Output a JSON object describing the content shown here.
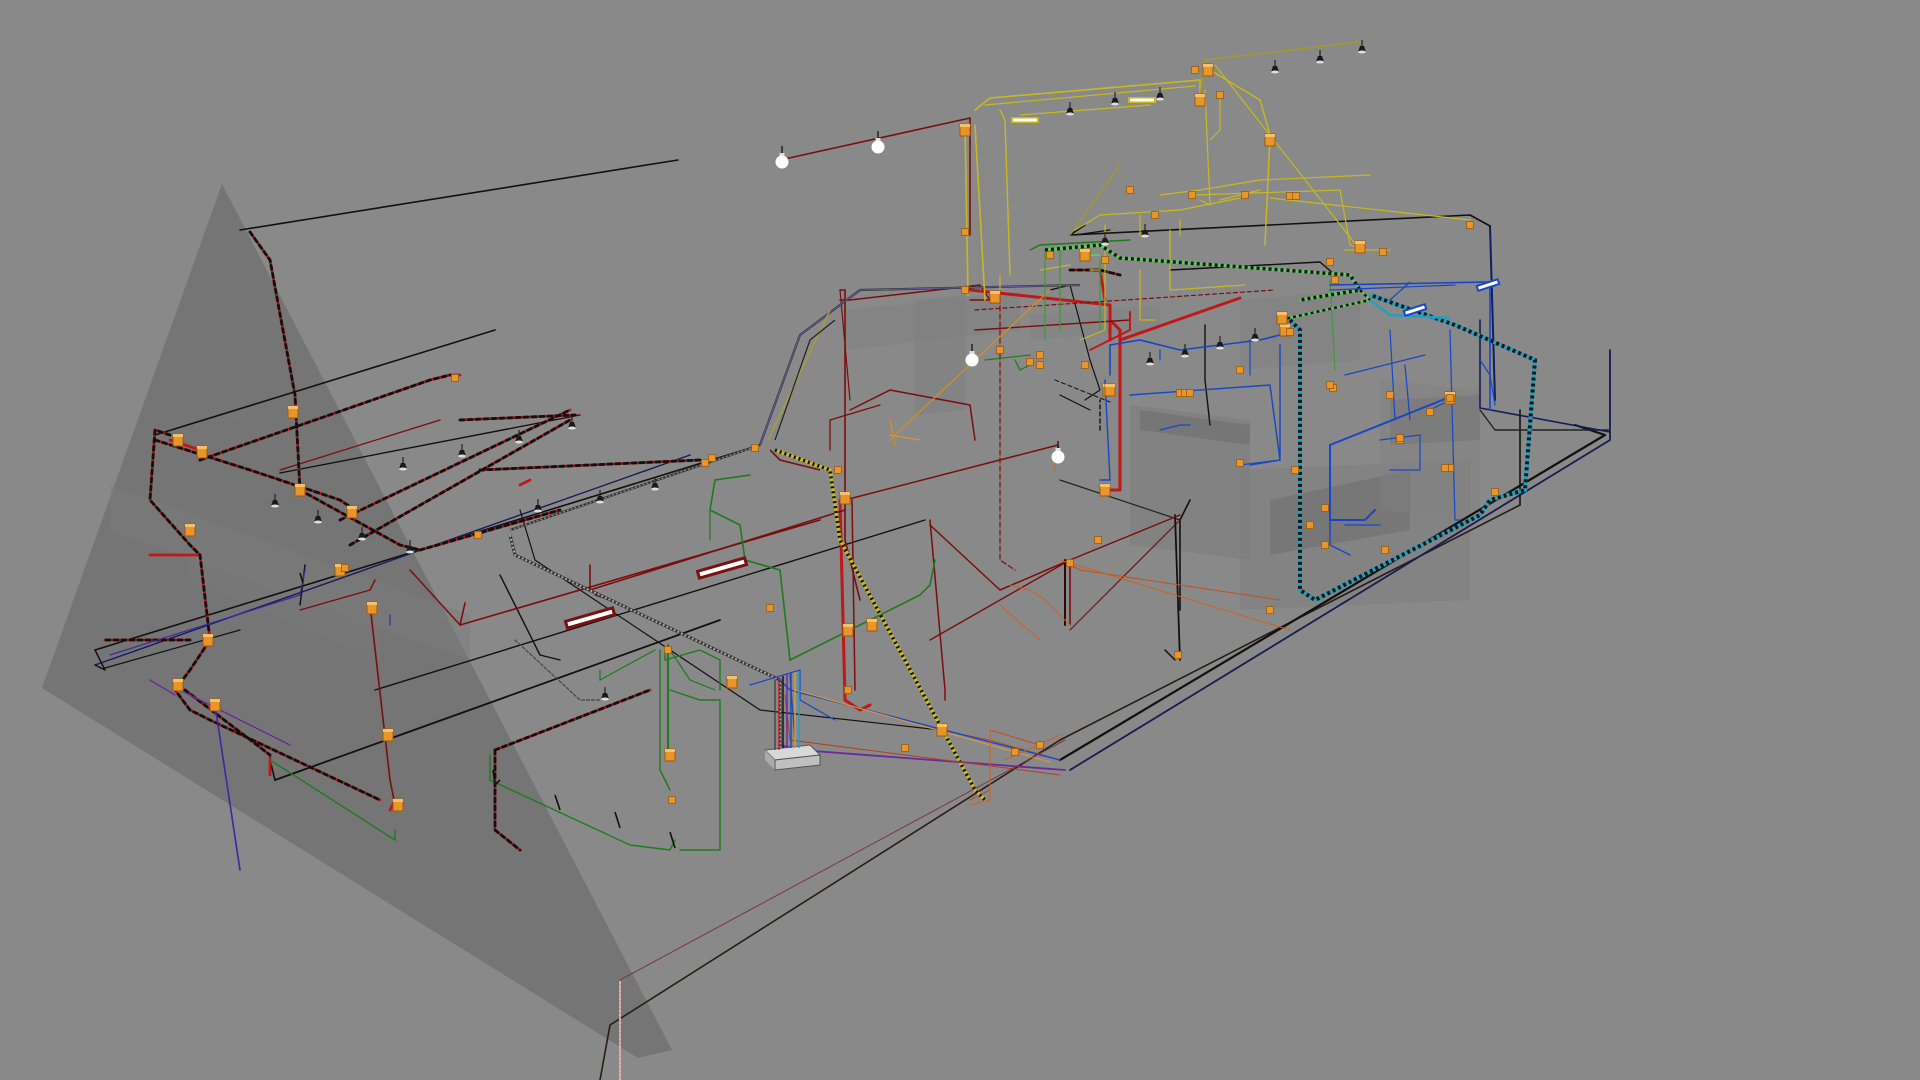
{
  "scene": {
    "kind": "3D electrical wiring model viewport",
    "background": "#898989",
    "circuit_colors": {
      "black": "#111111",
      "dark_red": "#7a0e0e",
      "red": "#c01818",
      "yellow": "#d8cc1a",
      "green": "#1f7a1f",
      "light_green": "#5ec85e",
      "blue": "#1846c8",
      "navy": "#141c5c",
      "cyan": "#22a0c0",
      "orange": "#e39a2a",
      "purple": "#6a2a9a",
      "pink_dotted": "#e0b0b0"
    },
    "component_icons": {
      "junction_box": "junction-box-icon",
      "light_bulb": "light-bulb-icon",
      "spot_light": "spot-light-icon",
      "fluorescent_fixture": "fluorescent-fixture-icon",
      "socket": "socket-icon"
    }
  }
}
